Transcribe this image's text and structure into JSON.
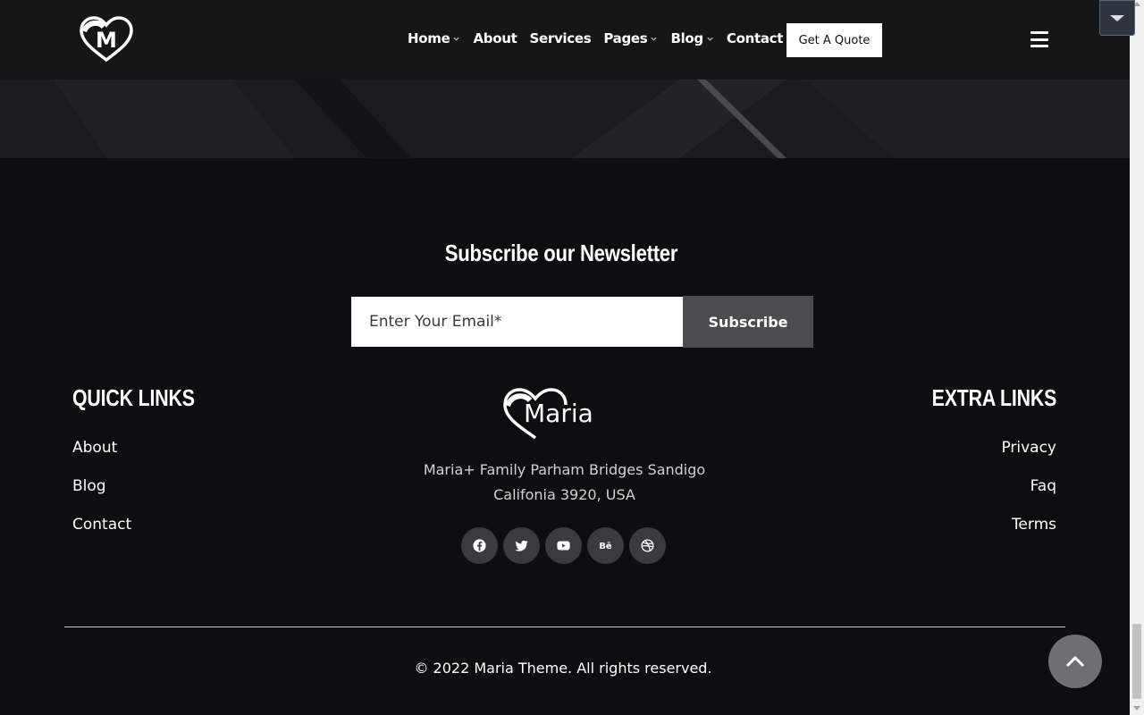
{
  "header": {
    "nav": [
      {
        "label": "Home",
        "has_dropdown": true
      },
      {
        "label": "About",
        "has_dropdown": false
      },
      {
        "label": "Services",
        "has_dropdown": false
      },
      {
        "label": "Pages",
        "has_dropdown": true
      },
      {
        "label": "Blog",
        "has_dropdown": true
      },
      {
        "label": "Contact",
        "has_dropdown": false
      }
    ],
    "quote_button": "Get A Quote",
    "logo_letter": "M"
  },
  "newsletter": {
    "title": "Subscribe our Newsletter",
    "email_placeholder": "Enter Your Email*",
    "email_value": "",
    "subscribe_label": "Subscribe"
  },
  "footer": {
    "quick_links_title": "QUICK LINKS",
    "quick_links": [
      "About",
      "Blog",
      "Contact"
    ],
    "extra_links_title": "EXTRA LINKS",
    "extra_links": [
      "Privacy",
      "Faq",
      "Terms"
    ],
    "brand_name": "Maria",
    "address_line1": "Maria+ Family Parham Bridges Sandigo",
    "address_line2": "Califonia 3920, USA",
    "social_icons": [
      "facebook-icon",
      "twitter-icon",
      "youtube-icon",
      "behance-icon",
      "dribbble-icon"
    ],
    "copyright": "© 2022 Maria Theme. All rights reserved."
  },
  "colors": {
    "background": "#0e0e10",
    "header": "#161616",
    "subscribe_button": "#4c4c4e",
    "social_circle": "#3b3b3d",
    "back_to_top": "#6f6f71"
  }
}
